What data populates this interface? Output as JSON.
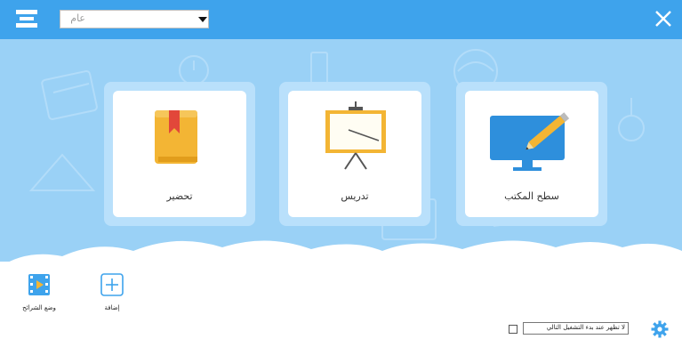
{
  "header": {
    "subject_select": {
      "value": "عام"
    }
  },
  "tiles": [
    {
      "id": "prepare",
      "label": "تحضير"
    },
    {
      "id": "teach",
      "label": "تدريس"
    },
    {
      "id": "desktop",
      "label": "سطح المكتب"
    }
  ],
  "footer": {
    "add_label": "إضافة",
    "slides_mode_label": "وضع الشرائح",
    "startup_label": "لا تظهر عند بدء التشغيل التالي"
  },
  "colors": {
    "topbar": "#3ea3ec",
    "background": "#9ad1f6",
    "tile_halo": "#b9e0fb",
    "icon_blue": "#2e8fdc"
  },
  "icons": [
    "menu-icon",
    "dropdown-arrow-icon",
    "close-icon",
    "book-icon",
    "whiteboard-icon",
    "monitor-pencil-icon",
    "add-icon",
    "slides-icon",
    "gear-icon"
  ]
}
